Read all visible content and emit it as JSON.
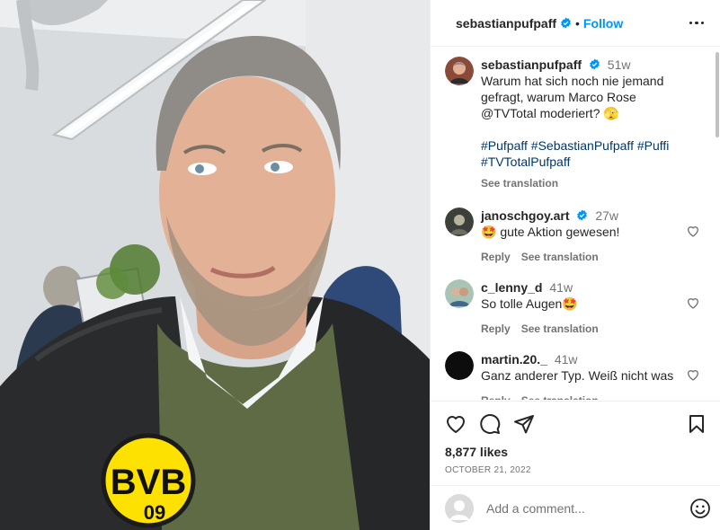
{
  "post": {
    "author": "sebastianpufpaff",
    "follow_label": "Follow",
    "dot": "•"
  },
  "caption": {
    "username": "sebastianpufpaff",
    "time": "51w",
    "text": "Warum hat sich noch nie jemand gefragt, warum Marco Rose @TVTotal moderiert? 🫣",
    "hashtags_line1": "#Pufpaff #SebastianPufpaff #Puffi",
    "hashtags_line2": "#TVTotalPufpaff",
    "see_translation": "See translation"
  },
  "comments": [
    {
      "username": "janoschgoy.art",
      "verified": true,
      "time": "27w",
      "text": "🤩 gute Aktion gewesen!",
      "reply": "Reply",
      "translate": "See translation"
    },
    {
      "username": "c_lenny_d",
      "verified": false,
      "time": "41w",
      "text": "So tolle Augen🤩",
      "reply": "Reply",
      "translate": "See translation"
    },
    {
      "username": "martin.20._",
      "verified": false,
      "time": "41w",
      "text": "Ganz anderer Typ. Weiß nicht was",
      "reply": "Reply",
      "translate": "See translation"
    }
  ],
  "stats": {
    "likes": "8,877 likes",
    "date": "OCTOBER 21, 2022"
  },
  "composer": {
    "placeholder": "Add a comment..."
  },
  "colors": {
    "accent": "#0095f6",
    "bvb_yellow": "#fde100",
    "sweater": "#5f6b45"
  },
  "photo_badge": {
    "line1": "BVB",
    "line2": "09"
  }
}
